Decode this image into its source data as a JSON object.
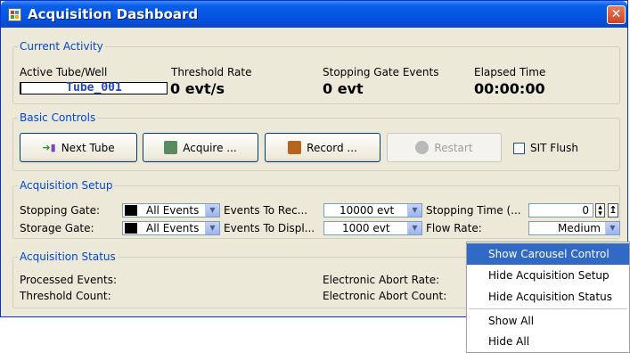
{
  "window": {
    "title": "Acquisition Dashboard",
    "close_glyph": "✕"
  },
  "current_activity": {
    "legend": "Current Activity",
    "tube_label": "Active Tube/Well",
    "tube_value": "Tube_001",
    "threshold_label": "Threshold Rate",
    "threshold_value": "0 evt/s",
    "stopping_label": "Stopping Gate Events",
    "stopping_value": "0 evt",
    "elapsed_label": "Elapsed Time",
    "elapsed_value": "00:00:00"
  },
  "basic_controls": {
    "legend": "Basic Controls",
    "next_tube": "Next Tube",
    "acquire": "Acquire ...",
    "record": "Record ...",
    "restart": "Restart",
    "sit_flush": "SIT Flush"
  },
  "acquisition_setup": {
    "legend": "Acquisition Setup",
    "stopping_gate_label": "Stopping Gate:",
    "stopping_gate_value": "All Events",
    "events_to_record_label": "Events To Rec...",
    "events_to_record_value": "10000 evt",
    "stopping_time_label": "Stopping Time (...",
    "stopping_time_value": "0",
    "storage_gate_label": "Storage Gate:",
    "storage_gate_value": "All Events",
    "events_to_display_label": "Events To Displ...",
    "events_to_display_value": "1000 evt",
    "flow_rate_label": "Flow Rate:",
    "flow_rate_value": "Medium"
  },
  "acquisition_status": {
    "legend": "Acquisition Status",
    "processed_events_label": "Processed Events:",
    "threshold_count_label": "Threshold Count:",
    "abort_rate_label": "Electronic Abort Rate:",
    "abort_count_label": "Electronic Abort Count:"
  },
  "context_menu": {
    "items": [
      "Show Carousel Control",
      "Hide Acquisition Setup",
      "Hide Acquisition Status",
      "Show All",
      "Hide All"
    ]
  },
  "colors": {
    "titlebar": "#0454e1",
    "group_legend": "#0046d5",
    "menu_highlight": "#316ac5",
    "acquire_icon": "#5a8a60",
    "record_icon": "#b5651d"
  }
}
